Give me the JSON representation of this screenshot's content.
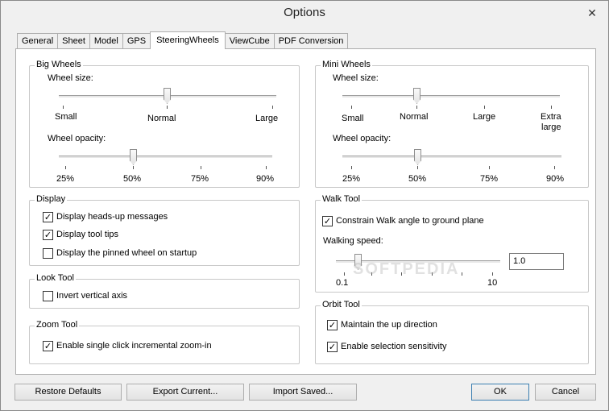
{
  "window": {
    "title": "Options",
    "close": "✕"
  },
  "tabs": [
    "General",
    "Sheet",
    "Model",
    "GPS",
    "SteeringWheels",
    "ViewCube",
    "PDF Conversion"
  ],
  "big_wheels": {
    "title": "Big Wheels",
    "size_label": "Wheel size:",
    "size_ticks": [
      "Small",
      "Normal",
      "Large"
    ],
    "size_value": "Normal",
    "opacity_label": "Wheel opacity:",
    "opacity_ticks": [
      "25%",
      "50%",
      "75%",
      "90%"
    ],
    "opacity_value": "50%"
  },
  "mini_wheels": {
    "title": "Mini Wheels",
    "size_label": "Wheel size:",
    "size_ticks": [
      "Small",
      "Normal",
      "Large",
      "Extra",
      "large"
    ],
    "size_value": "Normal",
    "opacity_label": "Wheel opacity:",
    "opacity_ticks": [
      "25%",
      "50%",
      "75%",
      "90%"
    ],
    "opacity_value": "50%"
  },
  "display": {
    "title": "Display",
    "options": [
      {
        "label": "Display heads-up messages",
        "checked": true
      },
      {
        "label": "Display tool tips",
        "checked": true
      },
      {
        "label": "Display the pinned wheel on startup",
        "checked": false
      }
    ]
  },
  "look_tool": {
    "title": "Look Tool",
    "options": [
      {
        "label": "Invert vertical axis",
        "checked": false
      }
    ]
  },
  "zoom_tool": {
    "title": "Zoom Tool",
    "options": [
      {
        "label": "Enable single click incremental zoom-in",
        "checked": true
      }
    ]
  },
  "walk_tool": {
    "title": "Walk Tool",
    "constrain": {
      "label": "Constrain Walk angle to ground plane",
      "checked": true
    },
    "speed_label": "Walking speed:",
    "speed_min": "0.1",
    "speed_max": "10",
    "speed_value": "1.0"
  },
  "orbit_tool": {
    "title": "Orbit Tool",
    "options": [
      {
        "label": "Maintain the up direction",
        "checked": true
      },
      {
        "label": "Enable selection sensitivity",
        "checked": true
      }
    ]
  },
  "buttons": {
    "restore": "Restore Defaults",
    "export": "Export Current...",
    "import": "Import Saved...",
    "ok": "OK",
    "cancel": "Cancel"
  },
  "watermark": "SOFTPEDIA"
}
